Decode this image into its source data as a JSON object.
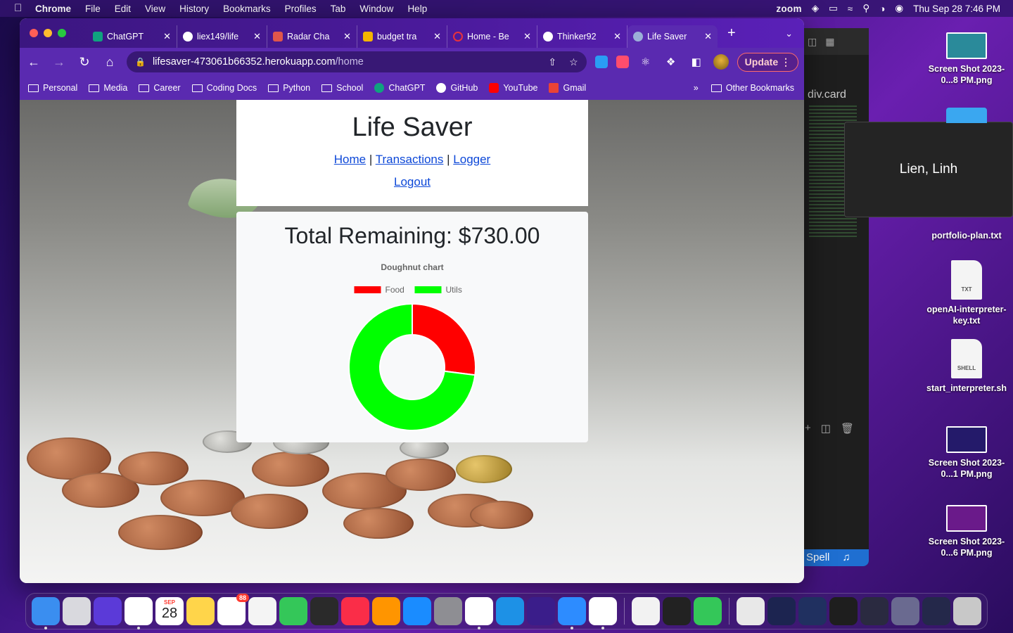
{
  "menubar": {
    "app": "Chrome",
    "items": [
      "File",
      "Edit",
      "View",
      "History",
      "Bookmarks",
      "Profiles",
      "Tab",
      "Window",
      "Help"
    ],
    "zoom_label": "zoom",
    "datetime": "Thu Sep 28  7:46 PM"
  },
  "tabs": [
    {
      "title": "ChatGPT",
      "favicon_color": "#10a37f"
    },
    {
      "title": "liex149/life",
      "favicon_color": "#ffffff"
    },
    {
      "title": "Radar Cha",
      "favicon_color": "#e0564b"
    },
    {
      "title": "budget tra",
      "favicon_color": "#f4b400"
    },
    {
      "title": "Home - Be",
      "favicon_color": "#e8323c"
    },
    {
      "title": "Thinker92",
      "favicon_color": "#ffffff"
    },
    {
      "title": "Life Saver",
      "favicon_color": "#9bb0d8"
    }
  ],
  "address": {
    "host": "lifesaver-473061b66352.herokuapp.com",
    "path": "/home"
  },
  "update_label": "Update",
  "bookmarks": [
    {
      "label": "Personal",
      "kind": "folder"
    },
    {
      "label": "Media",
      "kind": "folder"
    },
    {
      "label": "Career",
      "kind": "folder"
    },
    {
      "label": "Coding Docs",
      "kind": "folder"
    },
    {
      "label": "Python",
      "kind": "folder"
    },
    {
      "label": "School",
      "kind": "folder"
    },
    {
      "label": "ChatGPT",
      "kind": "site",
      "color": "#10a37f"
    },
    {
      "label": "GitHub",
      "kind": "site",
      "color": "#ffffff"
    },
    {
      "label": "YouTube",
      "kind": "site",
      "color": "#ff0000"
    },
    {
      "label": "Gmail",
      "kind": "site",
      "color": "#ea4335"
    }
  ],
  "other_bookmarks": "Other Bookmarks",
  "page": {
    "title": "Life Saver",
    "nav": {
      "home": "Home",
      "sep1": "|",
      "transactions": "Transactions",
      "sep2": "|",
      "logger": "Logger",
      "logout": "Logout"
    },
    "total_remaining": "Total Remaining: $730.00"
  },
  "chart_data": {
    "type": "doughnut",
    "title": "Doughnut chart",
    "legend_position": "top",
    "categories": [
      "Food",
      "Utils"
    ],
    "values": [
      27,
      73
    ],
    "colors": [
      "#ff0000",
      "#00ff00"
    ]
  },
  "editor": {
    "breadcrumb": "div.card",
    "status": "Spell"
  },
  "zoom_tile_name": "Lien, Linh",
  "desktop_items": [
    {
      "label": "Screen Shot 2023-0...8 PM.png",
      "kind": "image",
      "color": "#2a8a9a"
    },
    {
      "label": "portfolio-plan.txt",
      "kind": "txt"
    },
    {
      "label": "openAI-interpreter-key.txt",
      "kind": "txt"
    },
    {
      "label": "start_interpreter.sh",
      "kind": "shell"
    },
    {
      "label": "Screen Shot 2023-0...1 PM.png",
      "kind": "image",
      "color": "#241a6a"
    },
    {
      "label": "Screen Shot 2023-0...6 PM.png",
      "kind": "image",
      "color": "#6a1a8a"
    }
  ],
  "doc_badges": {
    "txt": "TXT",
    "shell": "SHELL"
  },
  "dock": {
    "calendar_month": "SEP",
    "calendar_day": "28",
    "reminders_badge": "88",
    "apps": [
      {
        "name": "finder",
        "color": "#3a8ef0"
      },
      {
        "name": "launchpad",
        "color": "#d9d9de"
      },
      {
        "name": "siri",
        "color": "#5b3ad8"
      },
      {
        "name": "chrome",
        "color": "#ffffff"
      },
      {
        "name": "calendar",
        "color": "#ffffff"
      },
      {
        "name": "notes",
        "color": "#ffd54a"
      },
      {
        "name": "reminders",
        "color": "#ffffff"
      },
      {
        "name": "photos",
        "color": "#f4f4f4"
      },
      {
        "name": "messages",
        "color": "#34c759"
      },
      {
        "name": "piano",
        "color": "#2a2a2a"
      },
      {
        "name": "music",
        "color": "#fa2d48"
      },
      {
        "name": "books",
        "color": "#ff9500"
      },
      {
        "name": "app-store",
        "color": "#1a8cff"
      },
      {
        "name": "system-settings",
        "color": "#8e8e93"
      },
      {
        "name": "vscode",
        "color": "#ffffff"
      },
      {
        "name": "docker",
        "color": "#1d91e6"
      },
      {
        "name": "proton-vpn",
        "color": "#3a1d8a"
      },
      {
        "name": "zoom",
        "color": "#2d8cff"
      },
      {
        "name": "slack",
        "color": "#ffffff"
      }
    ],
    "apps2": [
      {
        "name": "textedit",
        "color": "#f2f2f2"
      },
      {
        "name": "epic-games",
        "color": "#222222"
      },
      {
        "name": "facetime",
        "color": "#34c759"
      }
    ],
    "recents": [
      {
        "name": "archive",
        "color": "#e8e8e8"
      },
      {
        "name": "window-1",
        "color": "#1c2450"
      },
      {
        "name": "window-2",
        "color": "#203060"
      },
      {
        "name": "window-3",
        "color": "#1e1e1e"
      },
      {
        "name": "window-4",
        "color": "#2a2a40"
      },
      {
        "name": "window-5",
        "color": "#6a6a90"
      },
      {
        "name": "window-6",
        "color": "#24284a"
      },
      {
        "name": "trash",
        "color": "#c8c8c8"
      }
    ]
  }
}
